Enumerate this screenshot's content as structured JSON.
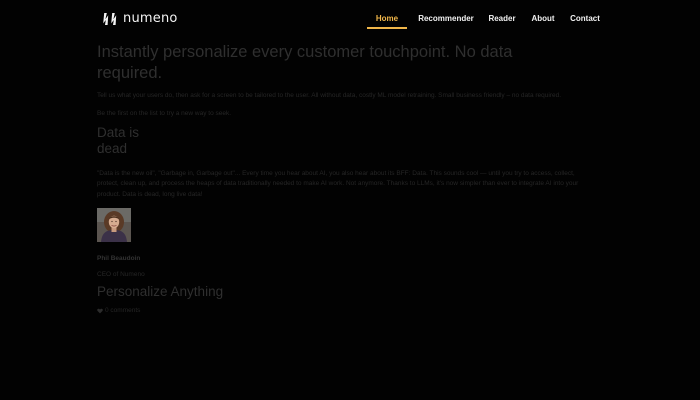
{
  "brand": {
    "name": "numeno",
    "accent_color": "#f0b64a",
    "logo_icon": "numeno-logo-icon"
  },
  "nav": {
    "items": [
      {
        "label": "Home",
        "active": true
      },
      {
        "label": "Recommender",
        "active": false
      },
      {
        "label": "Reader",
        "active": false
      },
      {
        "label": "About",
        "active": false
      },
      {
        "label": "Contact",
        "active": false
      }
    ]
  },
  "hero": {
    "title": "Instantly personalize every customer touchpoint. No data required.",
    "description": "Tell us what your users do, then ask for a screen to be tailored to the user.  All without data, costly ML model retraining.  Small business friendly – no data required.",
    "cta": "Be the first on the list to try a new way to seek."
  },
  "post": {
    "title": "Data is dead",
    "excerpt": "\"Data is the new oil\", \"Garbage in, Garbage out\"... Every time you hear about AI, you also hear about its BFF: Data. This sounds cool — until you try to access, collect, protect, clean up, and process the heaps of data traditionally needed to make AI work. Not anymore. Thanks to LLMs, it's now simpler than ever to integrate AI into your product. Data is dead, long live data!",
    "author": {
      "name": "Phil Beaudoin",
      "role": "CEO of Numeno",
      "photo": "author-photo"
    }
  },
  "section": {
    "title": "Personalize Anything",
    "comments": "0 comments",
    "comments_icon": "heart-icon"
  }
}
